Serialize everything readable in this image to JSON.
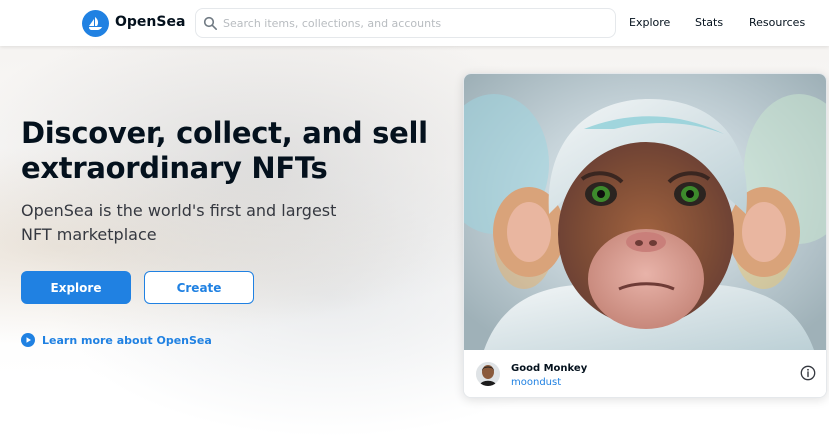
{
  "header": {
    "brand": "OpenSea",
    "search_placeholder": "Search items, collections, and accounts",
    "nav": [
      "Explore",
      "Stats",
      "Resources"
    ]
  },
  "hero": {
    "title": "Discover, collect, and sell extraordinary NFTs",
    "subtitle": "OpenSea is the world's first and largest NFT marketplace",
    "explore_label": "Explore",
    "create_label": "Create",
    "learn_more": "Learn more about OpenSea"
  },
  "featured": {
    "item_name": "Good Monkey",
    "creator": "moondust"
  },
  "icons": {
    "logo": "opensea-logo",
    "search": "search-icon",
    "learn": "play-circle-icon",
    "info": "info-icon"
  },
  "colors": {
    "accent": "#2081e2",
    "text": "#04111d"
  }
}
